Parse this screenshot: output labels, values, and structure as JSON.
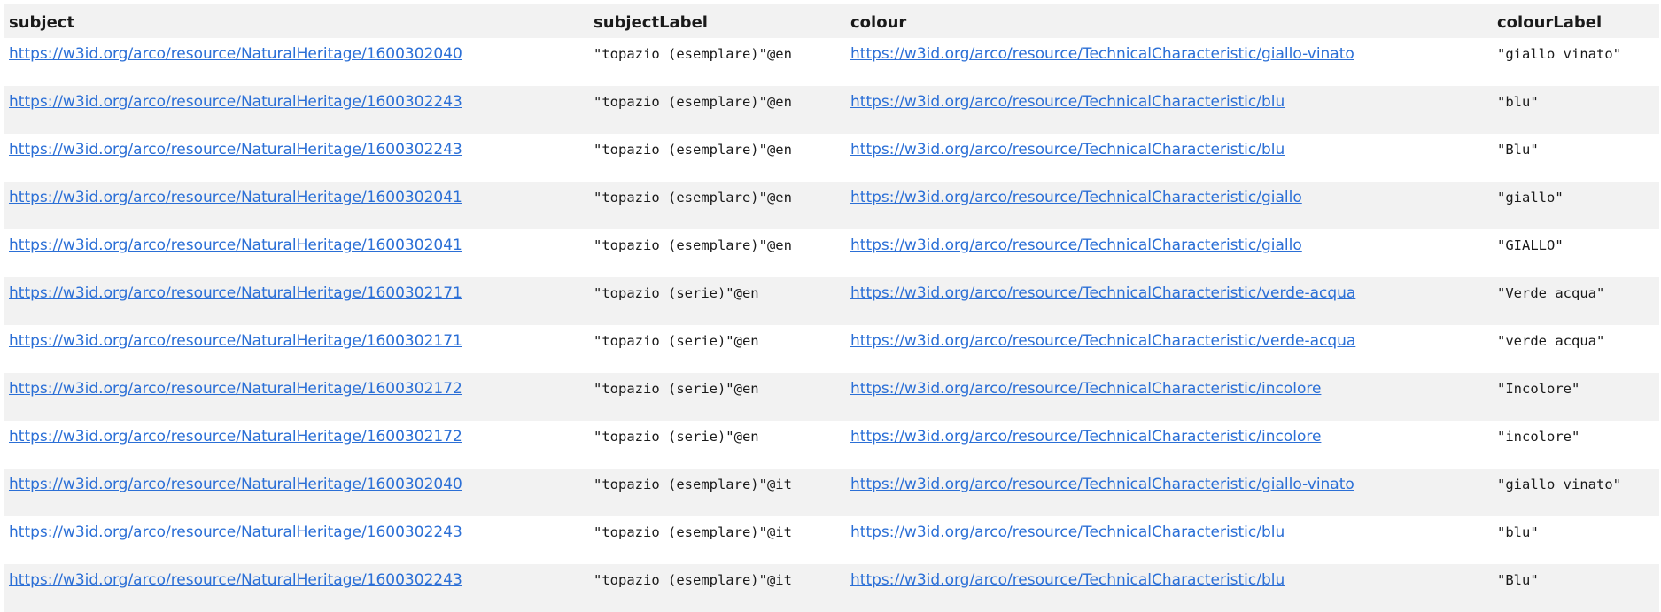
{
  "table": {
    "headers": [
      "subject",
      "subjectLabel",
      "colour",
      "colourLabel"
    ],
    "rows": [
      {
        "subject": "https://w3id.org/arco/resource/NaturalHeritage/1600302040",
        "subjectLabel": "\"topazio (esemplare)\"@en",
        "colour": "https://w3id.org/arco/resource/TechnicalCharacteristic/giallo-vinato",
        "colourLabel": "\"giallo vinato\""
      },
      {
        "subject": "https://w3id.org/arco/resource/NaturalHeritage/1600302243",
        "subjectLabel": "\"topazio (esemplare)\"@en",
        "colour": "https://w3id.org/arco/resource/TechnicalCharacteristic/blu",
        "colourLabel": "\"blu\""
      },
      {
        "subject": "https://w3id.org/arco/resource/NaturalHeritage/1600302243",
        "subjectLabel": "\"topazio (esemplare)\"@en",
        "colour": "https://w3id.org/arco/resource/TechnicalCharacteristic/blu",
        "colourLabel": "\"Blu\""
      },
      {
        "subject": "https://w3id.org/arco/resource/NaturalHeritage/1600302041",
        "subjectLabel": "\"topazio (esemplare)\"@en",
        "colour": "https://w3id.org/arco/resource/TechnicalCharacteristic/giallo",
        "colourLabel": "\"giallo\""
      },
      {
        "subject": "https://w3id.org/arco/resource/NaturalHeritage/1600302041",
        "subjectLabel": "\"topazio (esemplare)\"@en",
        "colour": "https://w3id.org/arco/resource/TechnicalCharacteristic/giallo",
        "colourLabel": "\"GIALLO\""
      },
      {
        "subject": "https://w3id.org/arco/resource/NaturalHeritage/1600302171",
        "subjectLabel": "\"topazio (serie)\"@en",
        "colour": "https://w3id.org/arco/resource/TechnicalCharacteristic/verde-acqua",
        "colourLabel": "\"Verde acqua\""
      },
      {
        "subject": "https://w3id.org/arco/resource/NaturalHeritage/1600302171",
        "subjectLabel": "\"topazio (serie)\"@en",
        "colour": "https://w3id.org/arco/resource/TechnicalCharacteristic/verde-acqua",
        "colourLabel": "\"verde acqua\""
      },
      {
        "subject": "https://w3id.org/arco/resource/NaturalHeritage/1600302172",
        "subjectLabel": "\"topazio (serie)\"@en",
        "colour": "https://w3id.org/arco/resource/TechnicalCharacteristic/incolore",
        "colourLabel": "\"Incolore\""
      },
      {
        "subject": "https://w3id.org/arco/resource/NaturalHeritage/1600302172",
        "subjectLabel": "\"topazio (serie)\"@en",
        "colour": "https://w3id.org/arco/resource/TechnicalCharacteristic/incolore",
        "colourLabel": "\"incolore\""
      },
      {
        "subject": "https://w3id.org/arco/resource/NaturalHeritage/1600302040",
        "subjectLabel": "\"topazio (esemplare)\"@it",
        "colour": "https://w3id.org/arco/resource/TechnicalCharacteristic/giallo-vinato",
        "colourLabel": "\"giallo vinato\""
      },
      {
        "subject": "https://w3id.org/arco/resource/NaturalHeritage/1600302243",
        "subjectLabel": "\"topazio (esemplare)\"@it",
        "colour": "https://w3id.org/arco/resource/TechnicalCharacteristic/blu",
        "colourLabel": "\"blu\""
      },
      {
        "subject": "https://w3id.org/arco/resource/NaturalHeritage/1600302243",
        "subjectLabel": "\"topazio (esemplare)\"@it",
        "colour": "https://w3id.org/arco/resource/TechnicalCharacteristic/blu",
        "colourLabel": "\"Blu\""
      }
    ]
  },
  "colors": {
    "link": "#2b6fd6",
    "header_bg": "#f2f2f2",
    "stripe_bg": "#f2f2f2"
  }
}
